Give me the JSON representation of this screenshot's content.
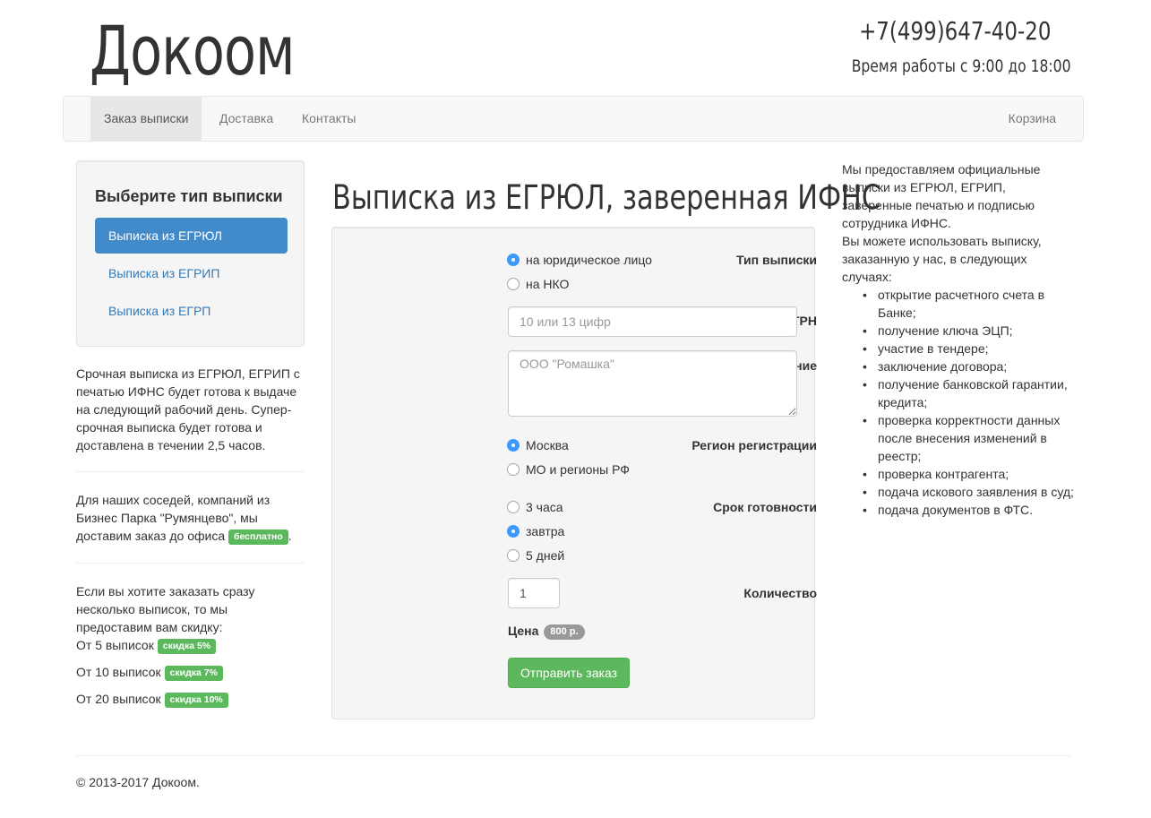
{
  "header": {
    "logo": "Докоом",
    "phone": "+7(499)647-40-20",
    "hours": "Время работы с 9:00 до 18:00"
  },
  "nav": {
    "items": [
      "Заказ выписки",
      "Доставка",
      "Контакты"
    ],
    "cart": "Корзина"
  },
  "sidebar": {
    "heading": "Выберите тип выписки",
    "pills": [
      "Выписка из ЕГРЮЛ",
      "Выписка из ЕГРИП",
      "Выписка из ЕГРП"
    ],
    "urgent_text": "Срочная выписка из ЕГРЮЛ, ЕГРИП с печатью ИФНС будет готова к выдаче на следующий рабочий день. Супер-срочная выписка будет готова и доставлена в течении 2,5 часов.",
    "neighbors_text": "Для наших соседей, компаний из Бизнес Парка \"Румянцево\", мы доставим заказ до офиса",
    "free_badge": "бесплатно",
    "discount_intro": "Если вы хотите заказать сразу несколько выписок, то мы предоставим вам скидку:",
    "discounts": [
      {
        "text": "От 5 выписок",
        "badge": "скидка 5%"
      },
      {
        "text": "От 10 выписок",
        "badge": "скидка 7%"
      },
      {
        "text": "От 20 выписок",
        "badge": "скидка 10%"
      }
    ]
  },
  "main": {
    "title": "Выписка из ЕГРЮЛ, заверенная ИФНС",
    "form": {
      "type_label": "Тип выписки",
      "type_options": [
        "на юридическое лицо",
        "на НКО"
      ],
      "inn_label": "ИНН или ОГРН",
      "inn_placeholder": "10 или 13 цифр",
      "name_label": "Название",
      "name_placeholder": "ООО \"Ромашка\"",
      "region_label": "Регион регистрации",
      "region_options": [
        "Москва",
        "МО и регионы РФ"
      ],
      "term_label": "Срок готовности",
      "term_options": [
        "3 часа",
        "завтра",
        "5 дней"
      ],
      "qty_label": "Количество",
      "qty_value": "1",
      "price_label": "Цена",
      "price_value": "800 р.",
      "submit": "Отправить заказ"
    }
  },
  "right": {
    "intro": "Мы предоставляем официальные выписки из ЕГРЮЛ, ЕГРИП, заверенные печатью и подписью сотрудника ИФНС.",
    "use_intro": "Вы можете использовать выписку, заказанную у нас, в следующих случаях:",
    "cases": [
      "открытие расчетного счета в Банке;",
      "получение ключа ЭЦП;",
      "участие в тендере;",
      "заключение договора;",
      "получение банковской гарантии, кредита;",
      "проверка корректности данных после внесения изменений в реестр;",
      "проверка контрагента;",
      "подача искового заявления в суд;",
      "подача документов в ФТС."
    ]
  },
  "footer": {
    "copyright_icon": "copyright-icon",
    "text": "2013-2017 Докоом."
  }
}
